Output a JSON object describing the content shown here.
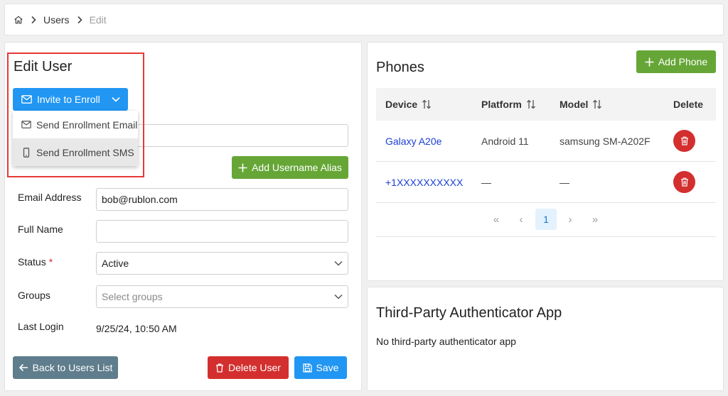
{
  "breadcrumb": {
    "home_icon": "home-icon",
    "items": [
      "Users",
      "Edit"
    ]
  },
  "edit_user": {
    "title": "Edit User",
    "invite_button": "Invite to Enroll",
    "dropdown": {
      "items": [
        {
          "label": "Send Enrollment Email",
          "icon": "mail-icon"
        },
        {
          "label": "Send Enrollment SMS",
          "icon": "phone-icon",
          "highlighted": true
        }
      ]
    },
    "add_alias_button": "Add Username Alias",
    "fields": {
      "email": {
        "label": "Email Address",
        "value": "bob@rublon.com"
      },
      "full_name": {
        "label": "Full Name",
        "value": ""
      },
      "status": {
        "label": "Status",
        "required_mark": "*",
        "value": "Active"
      },
      "groups": {
        "label": "Groups",
        "placeholder": "Select groups"
      },
      "last_login": {
        "label": "Last Login",
        "value": "9/25/24, 10:50 AM"
      }
    },
    "buttons": {
      "back": "Back to Users List",
      "delete": "Delete User",
      "save": "Save"
    }
  },
  "phones": {
    "title": "Phones",
    "add_button": "Add Phone",
    "columns": {
      "device": "Device",
      "platform": "Platform",
      "model": "Model",
      "delete": "Delete"
    },
    "rows": [
      {
        "device": "Galaxy A20e",
        "platform": "Android 11",
        "model": "samsung SM-A202F"
      },
      {
        "device": "+1XXXXXXXXXX",
        "platform": "—",
        "model": "—"
      }
    ],
    "pagination": {
      "first": "«",
      "prev": "‹",
      "current": "1",
      "next": "›",
      "last": "»"
    }
  },
  "third_party": {
    "title": "Third-Party Authenticator App",
    "empty_text": "No third-party authenticator app"
  },
  "colors": {
    "primary": "#2196f3",
    "success": "#66a636",
    "danger": "#d32f2f",
    "secondary": "#5f7d8c",
    "link": "#1a3fd6",
    "highlight_border": "#e53935"
  }
}
